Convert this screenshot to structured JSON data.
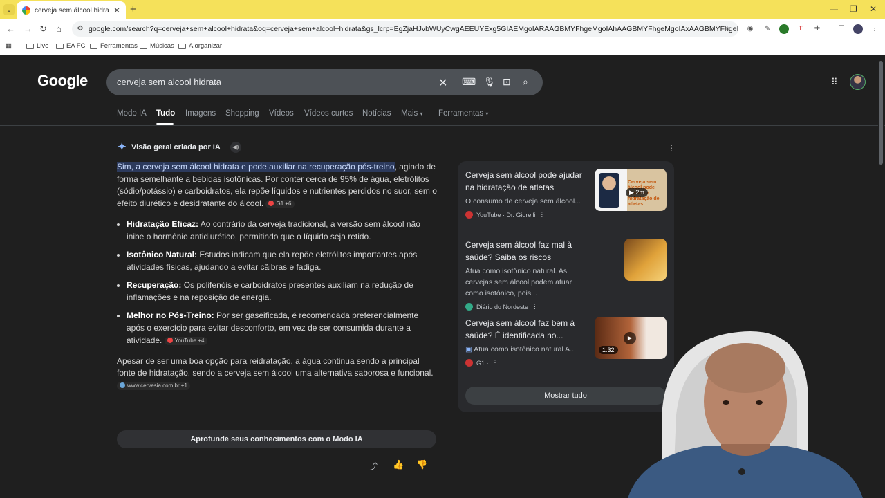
{
  "browser": {
    "tab_title": "cerveja sem álcool hidrata - Pes",
    "url": "google.com/search?q=cerveja+sem+alcool+hidrata&oq=cerveja+sem+alcool+hidrata&gs_lcrp=EgZjaHJvbWUyCwgAEEUYExg5GIAEMgoIARAAGBMYFhgeMgoIAhAAGBMYFhgeMgoIAxAAGBMYFhgeMgoIBBAAGIAE...",
    "bookmarks": [
      "Live",
      "EA FC",
      "Ferramentas",
      "Músicas",
      "A organizar"
    ]
  },
  "google": {
    "logo": "Google",
    "query": "cerveja sem alcool hidrata",
    "tabs": [
      "Modo IA",
      "Tudo",
      "Imagens",
      "Shopping",
      "Vídeos",
      "Vídeos curtos",
      "Notícias",
      "Mais",
      "Ferramentas"
    ]
  },
  "ai_overview": {
    "heading": "Visão geral criada por IA",
    "highlight": "Sim, a cerveja sem álcool hidrata e pode auxiliar na recuperação pós-treino",
    "intro_rest": ", agindo de forma semelhante a bebidas isotônicas. Por conter cerca de 95% de água, eletrólitos (sódio/potássio) e carboidratos, ela repõe líquidos e nutrientes perdidos no suor, sem o efeito diurético e desidratante do álcool.",
    "intro_chip": "G1 +6",
    "bullets": [
      {
        "title": "Hidratação Eficaz:",
        "text": " Ao contrário da cerveja tradicional, a versão sem álcool não inibe o hormônio antidiurético, permitindo que o líquido seja retido."
      },
      {
        "title": "Isotônico Natural:",
        "text": " Estudos indicam que ela repõe eletrólitos importantes após atividades físicas, ajudando a evitar cãibras e fadiga."
      },
      {
        "title": "Recuperação:",
        "text": " Os polifenóis e carboidratos presentes auxiliam na redução de inflamações e na reposição de energia."
      },
      {
        "title": "Melhor no Pós-Treino:",
        "text": " Por ser gaseificada, é recomendada preferencialmente após o exercício para evitar desconforto, em vez de ser consumida durante a atividade."
      }
    ],
    "bullet_chip": "YouTube +4",
    "closing": "Apesar de ser uma boa opção para reidratação, a água continua sendo a principal fonte de hidratação, sendo a cerveja sem álcool uma alternativa saborosa e funcional.",
    "closing_chip": "www.cervesia.com.br +1",
    "deeper_button": "Aprofunde seus conhecimentos com o Modo IA"
  },
  "sources": [
    {
      "title": "Cerveja sem álcool pode ajudar na hidratação de atletas",
      "snippet": "O consumo de cerveja sem álcool...",
      "source": "YouTube · Dr. Giorelli",
      "badge": "2m"
    },
    {
      "title": "Cerveja sem álcool faz mal à saúde? Saiba os riscos",
      "snippet": "Atua como isotônico natural. As cervejas sem álcool podem atuar como isotônico, pois...",
      "source": "Diário do Nordeste"
    },
    {
      "title": "Cerveja sem álcool faz bem à saúde? É identificada no...",
      "snippet": "Atua como isotônico natural A...",
      "source": "G1 ·",
      "badge": "1:32"
    }
  ],
  "show_all": "Mostrar tudo",
  "thumb_text": "Cerveja sem álcool pode ajudar na hidratação de atletas"
}
